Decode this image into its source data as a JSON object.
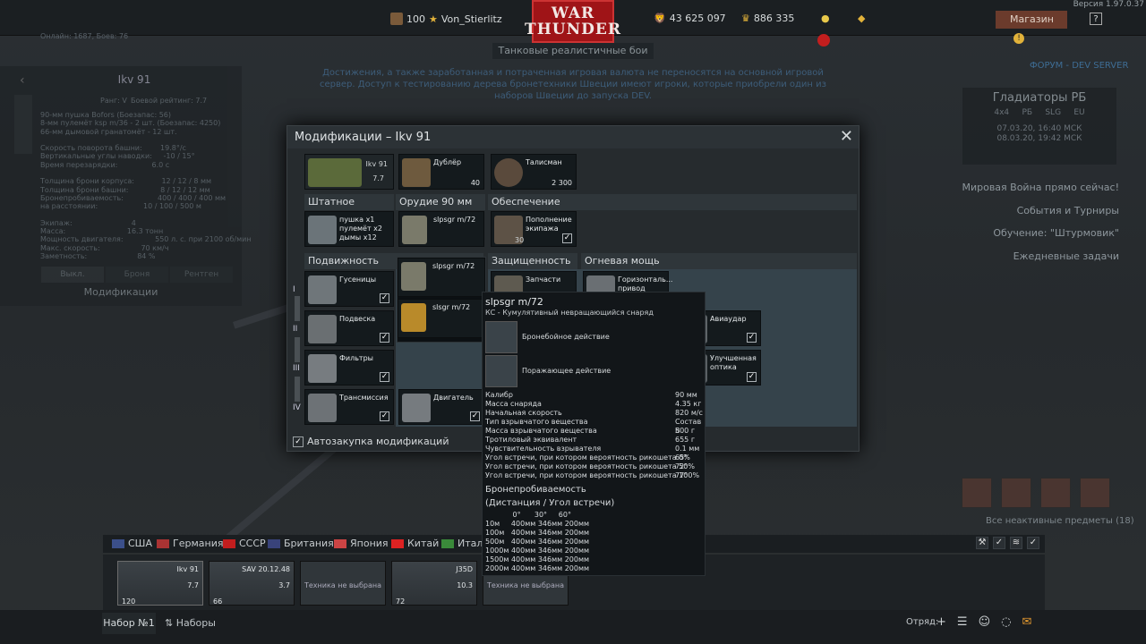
{
  "top": {
    "level": "100",
    "username": "Von_Stierlitz",
    "silver": "43 625 097",
    "gold": "886 335",
    "shop": "Магазин",
    "version": "Версия 1.97.0.37",
    "logo_line1": "WAR",
    "logo_line2": "THUNDER",
    "mode": "Танковые реалистичные бои",
    "online": "Онлайн: 1687, Боев: 76"
  },
  "notice": "Достижения, а также заработанная и потраченная игровая валюта не переносятся на основной игровой сервер. Доступ к тестированию дерева бронетехники Швеции имеют игроки, которые приобрели один из наборов Швеции до запуска DEV.",
  "left": {
    "title": "Ikv 91",
    "rank": "Ранг: V",
    "br": "Боевой рейтинг: 7.7",
    "stats": "90-мм пушка Bofors (Боезапас: 56)\n8-мм пулемёт ksp m/36 - 2 шт. (Боезапас: 4250)\n66-мм дымовой гранатомёт - 12 шт.\n\nСкорость поворота башни:        19.8°/с\nВертикальные углы наводки:     -10 / 15°\nВремя перезарядки:               6.0 с\n\nТолщина брони корпуса:            12 / 12 / 8 мм\nТолщина брони башни:              8 / 12 / 12 мм\nБронепробиваемость:               400 / 400 / 400 мм\nна расстоянии:                    10 / 100 / 500 м\n\nЭкипаж:                          4\nМасса:                           16.3 тонн\nМощность двигателя:              550 л. с. при 2100 об/мин\nМакс. скорость:                  70 км/ч\nЗаметность:                      84 %",
    "tabs": [
      "Выкл.",
      "Броня",
      "Рентген"
    ],
    "mods": "Модификации"
  },
  "right": {
    "forum": "ФОРУМ - DEV SERVER",
    "event_title": "Гладиаторы РБ",
    "event_tags": "4x4     РБ     SLG     EU",
    "event_dates": "07.03.20, 16:40 МСК\n08.03.20, 19:42 МСК",
    "links": [
      "Мировая Война прямо сейчас!",
      "События и Турниры",
      "Обучение: \"Штурмовик\"",
      "Ежедневные задачи"
    ],
    "inactive": "Все неактивные предметы (18)"
  },
  "modal": {
    "title": "Модификации – Ikv 91",
    "top_cells": [
      {
        "name": "Ikv 91",
        "br": "7.7"
      },
      {
        "name": "Дублёр",
        "count": "40"
      },
      {
        "name": "Талисман",
        "count": "2 300"
      }
    ],
    "sections": [
      "Штатное оружие",
      "Орудие 90 мм",
      "Обеспечение",
      "Подвижность",
      "Защищенность",
      "Огневая мощь"
    ],
    "weapon_cells": [
      {
        "name": "пушка x1\nпулемёт x2\nдымы x12"
      },
      {
        "name": "slpsgr m/72"
      },
      {
        "name": "Пополнение\nэкипажа",
        "count": "30"
      }
    ],
    "mobility": [
      "Гусеницы",
      "Подвеска",
      "Фильтры",
      "Трансмиссия"
    ],
    "engine": "Двигатель",
    "protection": [
      "Запчасти"
    ],
    "firepower": [
      "Горизонталь...\nпривод",
      "Авиаудар",
      "Улучшенная\nоптика"
    ],
    "tiers": [
      "I",
      "II",
      "III",
      "IV"
    ],
    "dropdown": [
      "slpsgr m/72",
      "slsgr m/72"
    ],
    "autobuy": "Автозакупка модификаций"
  },
  "tooltip": {
    "title": "slpsgr m/72",
    "subtitle": "КС - Кумулятивный невращающийся снаряд",
    "act1": "Бронебойное действие",
    "act2": "Поражающее действие",
    "rows": [
      [
        "Калибр",
        "90 мм"
      ],
      [
        "Масса снаряда",
        "4.35 кг"
      ],
      [
        "Начальная скорость",
        "820 м/с"
      ],
      [
        "Тип взрывчатого вещества",
        "Состав B"
      ],
      [
        "Масса взрывчатого вещества",
        "500 г"
      ],
      [
        "Тротиловый эквивалент",
        "655 г"
      ],
      [
        "Чувствительность взрывателя",
        "0.1 мм"
      ],
      [
        "Угол встречи, при котором вероятность рикошета 0%",
        "65°"
      ],
      [
        "Угол встречи, при котором вероятность рикошета 50%",
        "72°"
      ],
      [
        "Угол встречи, при котором вероятность рикошета 100%",
        "77°"
      ]
    ],
    "pen_title": "Бронепробиваемость",
    "pen_sub": "(Дистанция / Угол встречи)",
    "pen_table": "            0°      30°     60°\n10м     400мм 346мм 200мм\n100м   400мм 346мм 200мм\n500м   400мм 346мм 200мм\n1000м 400мм 346мм 200мм\n1500м 400мм 346мм 200мм\n2000м 400мм 346мм 200мм"
  },
  "nations": [
    "США",
    "Германия",
    "СССР",
    "Британия",
    "Япония",
    "Китай",
    "Итал"
  ],
  "slots": [
    {
      "name": "Ikv 91",
      "br": "7.7",
      "crew": "120"
    },
    {
      "name": "SAV 20.12.48",
      "br": "3.7",
      "crew": "66"
    },
    {
      "name": "Техника не выбрана",
      "empty": true
    },
    {
      "name": "J35D",
      "br": "10.3",
      "crew": "72"
    },
    {
      "name": "Техника не выбрана",
      "empty": true
    }
  ],
  "bottom": {
    "preset": "Набор №1",
    "presets": "Наборы",
    "squad": "Отряд:"
  },
  "colors": {
    "accent": "#9f1417",
    "highlight": "#35434b"
  }
}
